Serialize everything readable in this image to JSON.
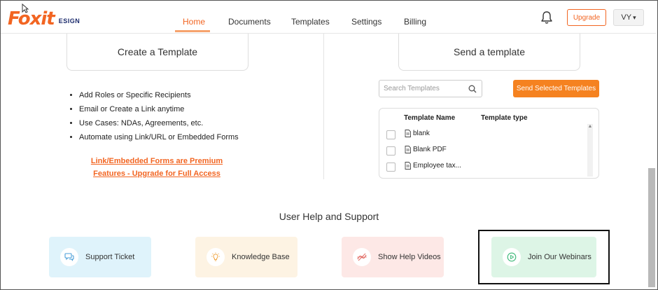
{
  "brand": {
    "logo_text": "Foxit",
    "logo_sub": "ESIGN",
    "accent_color": "#f26522"
  },
  "nav": {
    "items": [
      {
        "label": "Home",
        "active": true
      },
      {
        "label": "Documents",
        "active": false
      },
      {
        "label": "Templates",
        "active": false
      },
      {
        "label": "Settings",
        "active": false
      },
      {
        "label": "Billing",
        "active": false
      }
    ]
  },
  "header": {
    "bell_icon": "bell-icon",
    "upgrade_label": "Upgrade",
    "user_initials": "VY",
    "user_caret": "▾"
  },
  "create_template": {
    "title": "Create a Template",
    "features": [
      "Add Roles or Specific Recipients",
      "Email or Create a Link anytime",
      "Use Cases: NDAs, Agreements, etc.",
      "Automate using Link/URL or Embedded Forms"
    ],
    "premium_line1": "Link/Embedded Forms are Premium",
    "premium_line2": "Features - Upgrade for Full Access"
  },
  "send_template": {
    "title": "Send a template",
    "search_placeholder": "Search Templates",
    "send_button": "Send Selected Templates",
    "table": {
      "columns": [
        "Template Name",
        "Template type"
      ],
      "rows": [
        {
          "name": "blank",
          "type": ""
        },
        {
          "name": "Blank PDF",
          "type": ""
        },
        {
          "name": "Employee tax...",
          "type": ""
        }
      ]
    }
  },
  "help": {
    "title": "User Help and Support",
    "cards": [
      {
        "label": "Support Ticket",
        "icon": "chat-icon",
        "color": "#4a9fd8"
      },
      {
        "label": "Knowledge Base",
        "icon": "lightbulb-icon",
        "color": "#f0a94a"
      },
      {
        "label": "Show Help Videos",
        "icon": "video-icon",
        "color": "#e0625a"
      },
      {
        "label": "Join Our Webinars",
        "icon": "play-circle-icon",
        "color": "#3cb878"
      }
    ]
  }
}
